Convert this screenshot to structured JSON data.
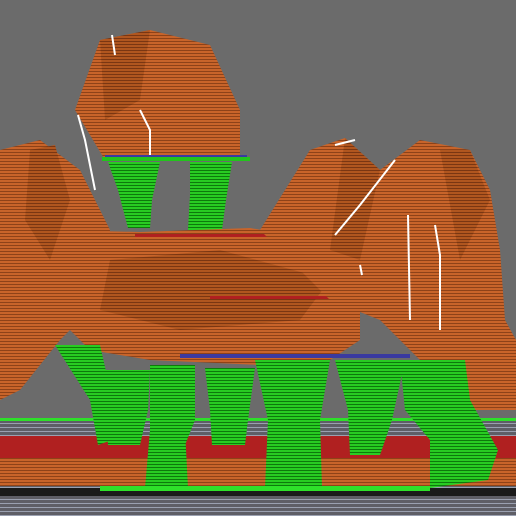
{
  "viewport": {
    "background": "#6b6b6b",
    "colors": {
      "model_layers": "#c8642a",
      "model_layers_dark": "#a44f1e",
      "layer_line": "#7a3a14",
      "perimeter_highlight": "#ffffff",
      "support_green": "#22c41c",
      "support_green_dark": "#128a10",
      "support_line": "#0b6a0a",
      "support_interface": "#3a3aa0",
      "bed_red": "#b02020",
      "bed_lines": "#9aa0b0",
      "raft_dark": "#1a1a1a",
      "skirt_green": "#2ee02a"
    },
    "icons": [
      "sliced-model-view"
    ]
  }
}
